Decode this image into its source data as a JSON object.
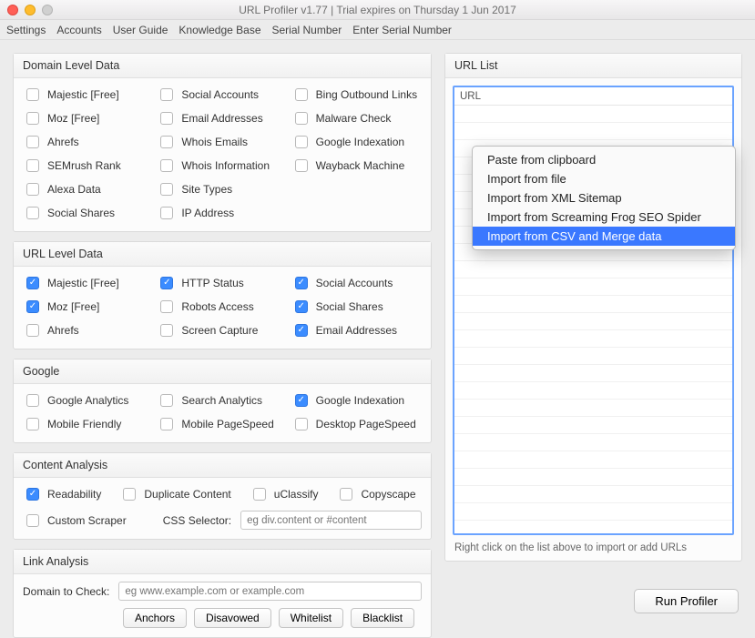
{
  "window": {
    "title": "URL Profiler v1.77 | Trial expires on Thursday 1 Jun 2017"
  },
  "menubar": [
    "Settings",
    "Accounts",
    "User Guide",
    "Knowledge Base",
    "Serial Number",
    "Enter Serial Number"
  ],
  "panels": {
    "domain_level": {
      "title": "Domain Level Data",
      "items": [
        [
          {
            "label": "Majestic [Free]",
            "checked": false
          },
          {
            "label": "Social Accounts",
            "checked": false
          },
          {
            "label": "Bing Outbound Links",
            "checked": false
          }
        ],
        [
          {
            "label": "Moz [Free]",
            "checked": false
          },
          {
            "label": "Email Addresses",
            "checked": false
          },
          {
            "label": "Malware Check",
            "checked": false
          }
        ],
        [
          {
            "label": "Ahrefs",
            "checked": false
          },
          {
            "label": "Whois Emails",
            "checked": false
          },
          {
            "label": "Google Indexation",
            "checked": false
          }
        ],
        [
          {
            "label": "SEMrush Rank",
            "checked": false
          },
          {
            "label": "Whois Information",
            "checked": false
          },
          {
            "label": "Wayback Machine",
            "checked": false
          }
        ],
        [
          {
            "label": "Alexa Data",
            "checked": false
          },
          {
            "label": "Site Types",
            "checked": false
          }
        ],
        [
          {
            "label": "Social Shares",
            "checked": false
          },
          {
            "label": "IP Address",
            "checked": false
          }
        ]
      ]
    },
    "url_level": {
      "title": "URL Level Data",
      "items": [
        [
          {
            "label": "Majestic [Free]",
            "checked": true
          },
          {
            "label": "HTTP Status",
            "checked": true
          },
          {
            "label": "Social Accounts",
            "checked": true
          }
        ],
        [
          {
            "label": "Moz [Free]",
            "checked": true
          },
          {
            "label": "Robots Access",
            "checked": false
          },
          {
            "label": "Social Shares",
            "checked": true
          }
        ],
        [
          {
            "label": "Ahrefs",
            "checked": false
          },
          {
            "label": "Screen Capture",
            "checked": false
          },
          {
            "label": "Email Addresses",
            "checked": true
          }
        ]
      ]
    },
    "google": {
      "title": "Google",
      "items": [
        [
          {
            "label": "Google Analytics",
            "checked": false
          },
          {
            "label": "Search Analytics",
            "checked": false
          },
          {
            "label": "Google Indexation",
            "checked": true
          }
        ],
        [
          {
            "label": "Mobile Friendly",
            "checked": false
          },
          {
            "label": "Mobile PageSpeed",
            "checked": false
          },
          {
            "label": "Desktop PageSpeed",
            "checked": false
          }
        ]
      ]
    },
    "content": {
      "title": "Content Analysis",
      "row1": [
        {
          "label": "Readability",
          "checked": true
        },
        {
          "label": "Duplicate Content",
          "checked": false
        },
        {
          "label": "uClassify",
          "checked": false
        },
        {
          "label": "Copyscape",
          "checked": false
        }
      ],
      "custom_scraper": {
        "label": "Custom Scraper",
        "checked": false
      },
      "css_label": "CSS Selector:",
      "css_placeholder": "eg div.content or #content"
    },
    "link": {
      "title": "Link Analysis",
      "field_label": "Domain to Check:",
      "field_placeholder": "eg www.example.com or example.com",
      "buttons": [
        "Anchors",
        "Disavowed",
        "Whitelist",
        "Blacklist"
      ]
    },
    "url_list": {
      "title": "URL List",
      "column": "URL",
      "hint": "Right click on the list above to import or add URLs"
    }
  },
  "context_menu": [
    {
      "label": "Paste from clipboard",
      "selected": false
    },
    {
      "label": "Import from file",
      "selected": false
    },
    {
      "label": "Import from XML Sitemap",
      "selected": false
    },
    {
      "label": "Import from Screaming Frog SEO Spider",
      "selected": false
    },
    {
      "label": "Import from CSV and Merge data",
      "selected": true
    }
  ],
  "footer": {
    "run": "Run Profiler"
  }
}
